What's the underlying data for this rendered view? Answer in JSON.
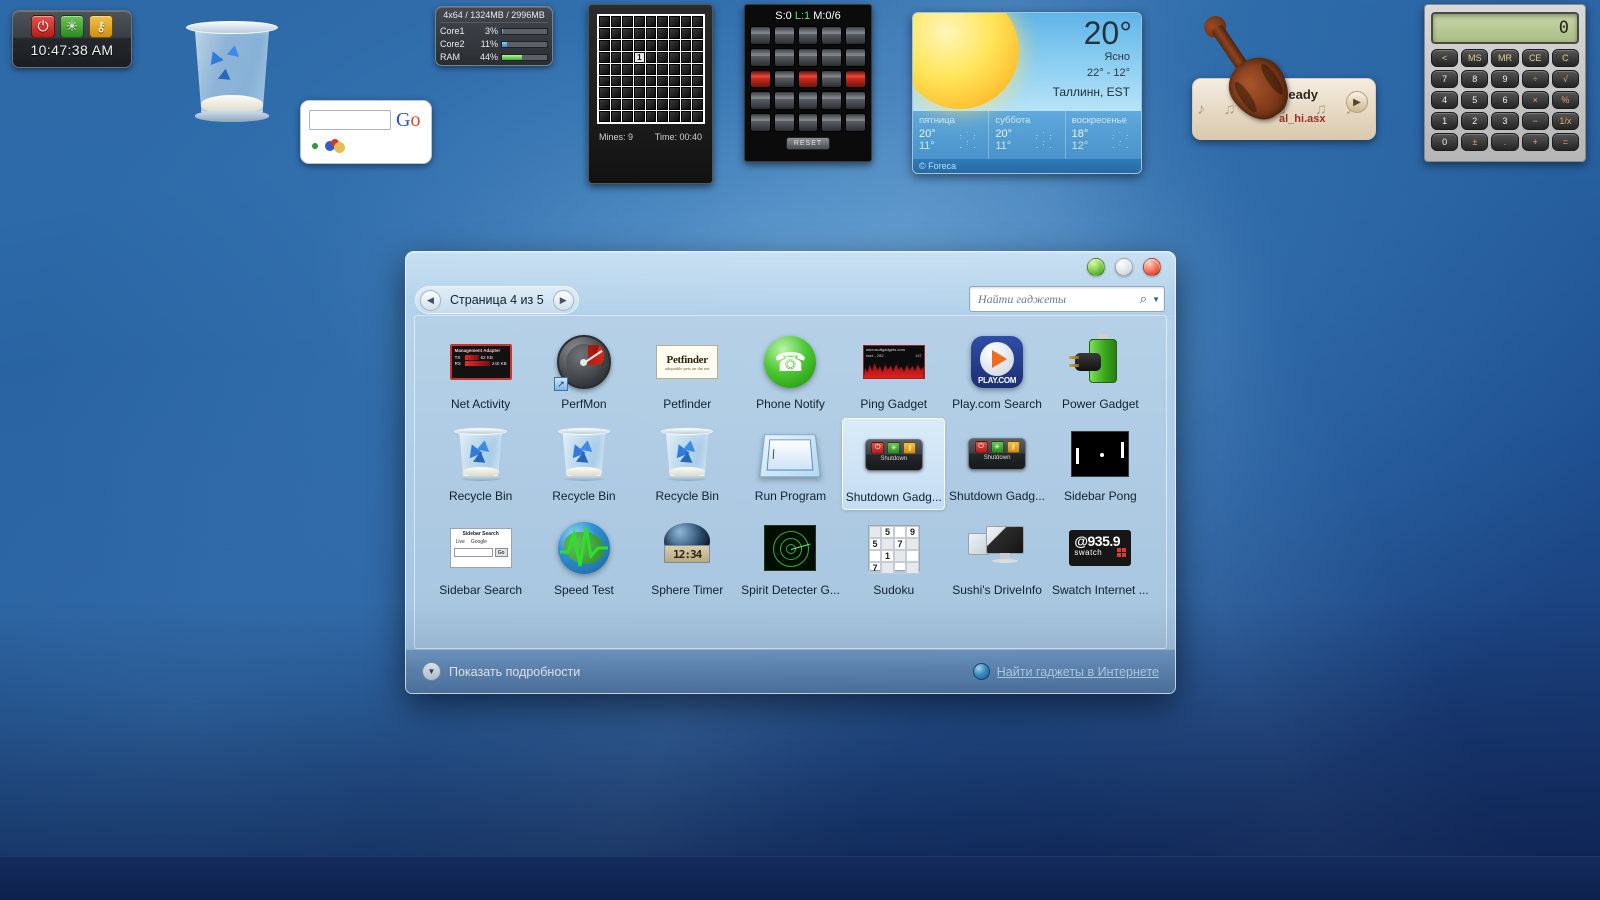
{
  "desktop": {
    "shutdown_gadget": {
      "time": "10:47:38 AM",
      "power_icon": "power-icon",
      "restart_icon": "restart-icon",
      "lock_icon": "lock-icon"
    },
    "recycle_bin_icon": "recycle-bin-icon",
    "google_gadget": {
      "input_value": "",
      "go_b": "G",
      "go_o": "o"
    },
    "perfmon_gadget": {
      "header": "4x64 / 1324MB / 2996MB",
      "rows": [
        {
          "label": "Core1",
          "value": "3%",
          "percent": 3,
          "color": "blue"
        },
        {
          "label": "Core2",
          "value": "11%",
          "percent": 11,
          "color": "blue"
        },
        {
          "label": "RAM",
          "value": "44%",
          "percent": 44,
          "color": "green"
        }
      ]
    },
    "minesweeper_gadget": {
      "mines": "Mines: 9",
      "time": "Time: 00:40",
      "revealed_cell": "1"
    },
    "lights_gadget": {
      "score": "S:0",
      "level": "L:1",
      "moves": "M:0/6",
      "reset_label": "RESET"
    },
    "weather_gadget": {
      "temp": "20°",
      "condition": "Ясно",
      "high_low": "22°  -  12°",
      "city": "Таллинн, EST",
      "provider": "© Foreca",
      "days": [
        {
          "name": "пятница",
          "high": "20°",
          "low": "11°"
        },
        {
          "name": "суббота",
          "high": "20°",
          "low": "11°"
        },
        {
          "name": "воскресенье",
          "high": "18°",
          "low": "12°"
        }
      ]
    },
    "violin_gadget": {
      "status": "Ready",
      "file": "al_hi.asx",
      "play_icon": "play-icon"
    },
    "calculator_gadget": {
      "display": "0",
      "keys": [
        "<",
        "MS",
        "MR",
        "CE",
        "C",
        "7",
        "8",
        "9",
        "÷",
        "√",
        "4",
        "5",
        "6",
        "×",
        "%",
        "1",
        "2",
        "3",
        "−",
        "1/x",
        "0",
        "±",
        ".",
        "+",
        "="
      ]
    }
  },
  "gallery": {
    "window_buttons": {
      "minimize": "minimize-button",
      "maximize": "maximize-button",
      "close": "close-button"
    },
    "pager": {
      "prev_icon": "◀",
      "label": "Страница 4 из 5",
      "next_icon": "▶"
    },
    "search": {
      "placeholder": "Найти гаджеты",
      "value": "",
      "search_icon": "search-icon",
      "chevron_icon": "▼"
    },
    "gadgets": [
      {
        "label": "Net Activity",
        "icon": "net-activity-icon",
        "selected": false
      },
      {
        "label": "PerfMon",
        "icon": "perfmon-icon",
        "selected": false
      },
      {
        "label": "Petfinder",
        "icon": "petfinder-icon",
        "selected": false
      },
      {
        "label": "Phone Notify",
        "icon": "phone-notify-icon",
        "selected": false
      },
      {
        "label": "Ping Gadget",
        "icon": "ping-gadget-icon",
        "selected": false
      },
      {
        "label": "Play.com Search",
        "icon": "play-com-icon",
        "selected": false
      },
      {
        "label": "Power Gadget",
        "icon": "power-gadget-icon",
        "selected": false
      },
      {
        "label": "Recycle Bin",
        "icon": "recycle-bin-icon",
        "selected": false
      },
      {
        "label": "Recycle Bin",
        "icon": "recycle-bin-icon",
        "selected": false
      },
      {
        "label": "Recycle Bin",
        "icon": "recycle-bin-icon",
        "selected": false
      },
      {
        "label": "Run Program",
        "icon": "run-program-icon",
        "selected": false
      },
      {
        "label": "Shutdown Gadg...",
        "icon": "shutdown-gadget-icon",
        "selected": true
      },
      {
        "label": "Shutdown Gadg...",
        "icon": "shutdown-gadget-icon",
        "selected": false
      },
      {
        "label": "Sidebar Pong",
        "icon": "sidebar-pong-icon",
        "selected": false
      },
      {
        "label": "Sidebar Search",
        "icon": "sidebar-search-icon",
        "selected": false
      },
      {
        "label": "Speed Test",
        "icon": "speed-test-icon",
        "selected": false
      },
      {
        "label": "Sphere Timer",
        "icon": "sphere-timer-icon",
        "selected": false
      },
      {
        "label": "Spirit Detecter G...",
        "icon": "spirit-detector-icon",
        "selected": false
      },
      {
        "label": "Sudoku",
        "icon": "sudoku-icon",
        "selected": false
      },
      {
        "label": "Sushi's DriveInfo",
        "icon": "drive-info-icon",
        "selected": false
      },
      {
        "label": "Swatch Internet ...",
        "icon": "swatch-icon",
        "selected": false
      }
    ],
    "icon_text": {
      "net_activity": {
        "title": "Management Adapter",
        "tx_label": "TX",
        "tx_value": "62 KB",
        "rx_label": "RX",
        "rx_value": "240 KB"
      },
      "petfinder": {
        "title": "Petfinder",
        "subtitle": "adoptable pets on the net"
      },
      "ping": {
        "host": "microsoftgadgets.com",
        "max": "max - 282",
        "cur": "147"
      },
      "play": {
        "brand": "PLAY.COM"
      },
      "shutdown": {
        "label": "Shutdown"
      },
      "sidebar_search": {
        "title": "Sidebar Search",
        "live": "Live",
        "google": "Google",
        "go": "Go"
      },
      "sphere_timer": {
        "time": "12:34"
      },
      "sudoku": {
        "cells": [
          "",
          "5",
          "",
          "9",
          "5",
          "",
          "7",
          "",
          "",
          "1",
          "",
          "",
          "7",
          "",
          "",
          ""
        ]
      },
      "swatch": {
        "beat": "@935.9",
        "brand": "swatch"
      }
    },
    "footer": {
      "details_label": "Показать подробности",
      "details_icon": "chevron-down-icon",
      "online_label": "Найти гаджеты в Интернете",
      "globe_icon": "globe-icon"
    }
  }
}
